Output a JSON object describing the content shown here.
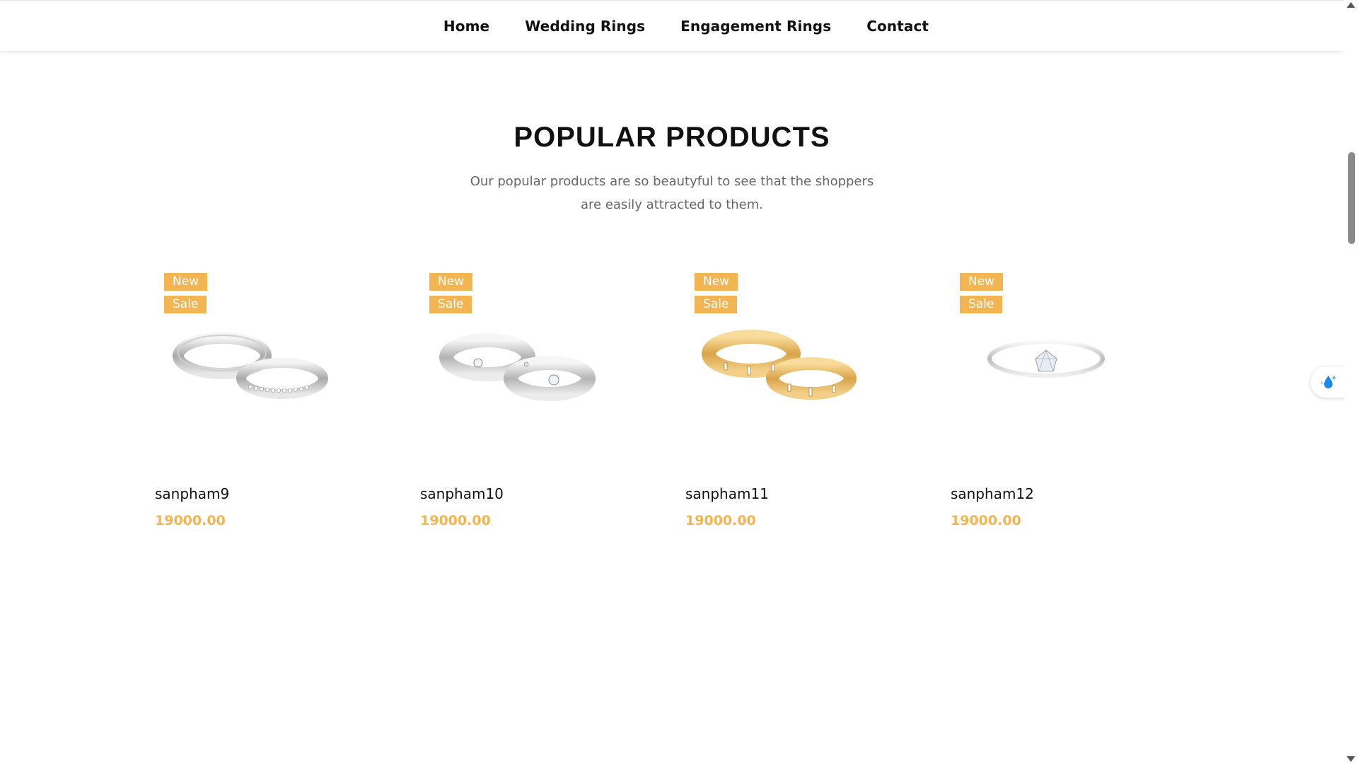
{
  "nav": {
    "items": [
      {
        "label": "Home"
      },
      {
        "label": "Wedding Rings"
      },
      {
        "label": "Engagement Rings"
      },
      {
        "label": "Contact"
      }
    ]
  },
  "section": {
    "title": "POPULAR PRODUCTS",
    "subtitle": "Our popular products are so beautyful to see that the shoppers are easily attracted to them."
  },
  "products": [
    {
      "name": "sanpham9",
      "price": "19000.00",
      "badges": [
        "New",
        "Sale"
      ],
      "image": "silver-wedding-ring-pair-icon"
    },
    {
      "name": "sanpham10",
      "price": "19000.00",
      "badges": [
        "New",
        "Sale"
      ],
      "image": "silver-diamond-ring-pair-icon"
    },
    {
      "name": "sanpham11",
      "price": "19000.00",
      "badges": [
        "New",
        "Sale"
      ],
      "image": "gold-ring-pair-icon"
    },
    {
      "name": "sanpham12",
      "price": "19000.00",
      "badges": [
        "New",
        "Sale"
      ],
      "image": "solitaire-engagement-ring-icon"
    }
  ],
  "colors": {
    "accent": "#f2b552",
    "text": "#111111",
    "muted": "#666666"
  },
  "widget": {
    "icon": "water-drop-sparkle-icon"
  }
}
